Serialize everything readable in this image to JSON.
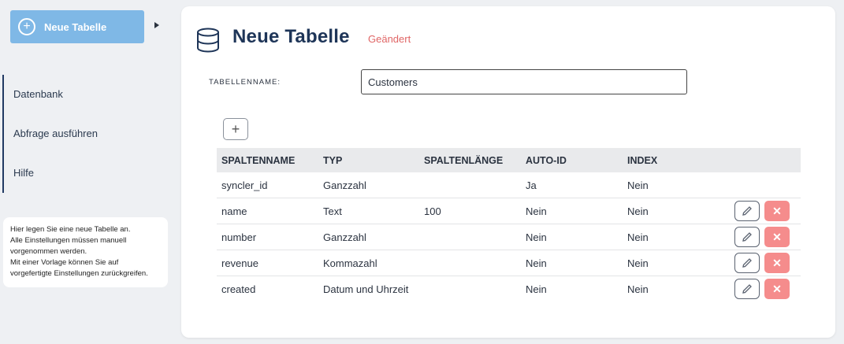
{
  "sidebar": {
    "new_button_label": "Neue Tabelle",
    "nav_items": [
      {
        "label": "Datenbank"
      },
      {
        "label": "Abfrage ausführen"
      },
      {
        "label": "Hilfe"
      }
    ],
    "help_text": [
      "Hier legen Sie eine neue Tabelle an.",
      "Alle Einstellungen müssen manuell",
      "vorgenommen werden.",
      "Mit einer Vorlage können Sie auf",
      "vorgefertigte Einstellungen zurückgreifen."
    ]
  },
  "main": {
    "title": "Neue Tabelle",
    "status": "Geändert",
    "table_name_label": "TABELLENNAME:",
    "table_name_value": "Customers",
    "add_column_icon": "plus-icon",
    "columns_header": [
      "SPALTENNAME",
      "TYP",
      "SPALTENLÄNGE",
      "AUTO-ID",
      "INDEX"
    ],
    "rows": [
      {
        "name": "syncler_id",
        "type": "Ganzzahl",
        "length": "",
        "auto_id": "Ja",
        "index": "Nein",
        "editable": false
      },
      {
        "name": "name",
        "type": "Text",
        "length": "100",
        "auto_id": "Nein",
        "index": "Nein",
        "editable": true
      },
      {
        "name": "number",
        "type": "Ganzzahl",
        "length": "",
        "auto_id": "Nein",
        "index": "Nein",
        "editable": true
      },
      {
        "name": "revenue",
        "type": "Kommazahl",
        "length": "",
        "auto_id": "Nein",
        "index": "Nein",
        "editable": true
      },
      {
        "name": "created",
        "type": "Datum und Uhrzeit",
        "length": "",
        "auto_id": "Nein",
        "index": "Nein",
        "editable": true
      }
    ]
  },
  "colors": {
    "accent_button": "#7fb8e6",
    "title": "#1e3558",
    "status": "#e06666",
    "delete": "#f58c8c"
  }
}
